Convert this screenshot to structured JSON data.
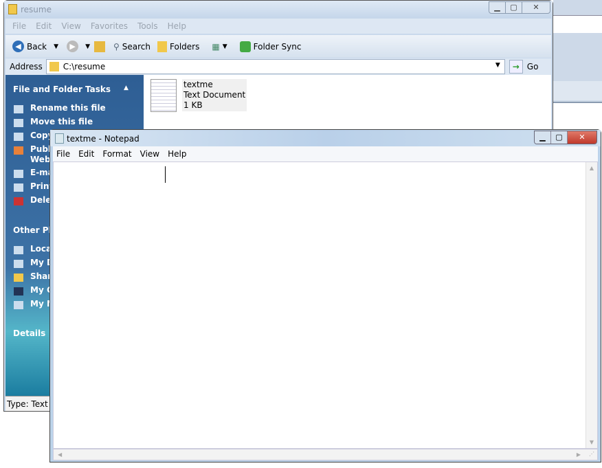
{
  "explorer": {
    "title": "resume",
    "menu": [
      "File",
      "Edit",
      "View",
      "Favorites",
      "Tools",
      "Help"
    ],
    "toolbar": {
      "back": "Back",
      "search": "Search",
      "folders": "Folders",
      "folder_sync": "Folder Sync"
    },
    "address": {
      "label": "Address",
      "value": "C:\\resume",
      "go": "Go"
    },
    "tasks": {
      "file_folder_header": "File and Folder Tasks",
      "file_folder_items": [
        "Rename this file",
        "Move this file",
        "Copy",
        "Publi",
        "Web",
        "E-ma",
        "Print",
        "Delet"
      ],
      "other_places_header": "Other Pla",
      "other_places_items": [
        "Local",
        "My D",
        "Share",
        "My C",
        "My N"
      ],
      "details_header": "Details"
    },
    "file": {
      "name": "textme",
      "type": "Text Document",
      "size": "1 KB"
    },
    "status": "Type: Text D"
  },
  "notepad": {
    "title": "textme - Notepad",
    "menu": [
      "File",
      "Edit",
      "Format",
      "View",
      "Help"
    ],
    "content": ""
  }
}
